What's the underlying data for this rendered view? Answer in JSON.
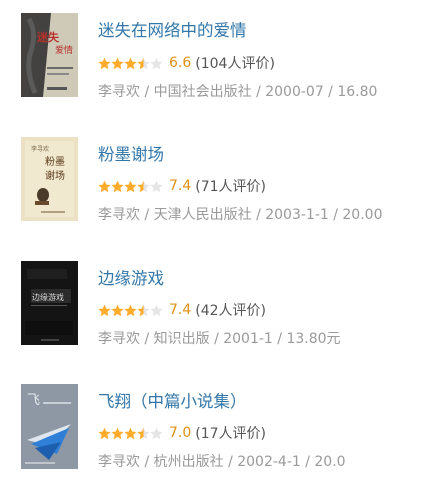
{
  "books": [
    {
      "title": "迷失在网络中的爱情",
      "rating": "6.6",
      "rating_value": 3.5,
      "count": "(104人评价)",
      "meta": "李寻欢 / 中国社会出版社 / 2000-07 / 16.80"
    },
    {
      "title": "粉墨谢场",
      "rating": "7.4",
      "rating_value": 3.5,
      "count": "(71人评价)",
      "meta": "李寻欢 / 天津人民出版社 / 2003-1-1 / 20.00"
    },
    {
      "title": "边缘游戏",
      "rating": "7.4",
      "rating_value": 3.5,
      "count": "(42人评价)",
      "meta": "李寻欢 / 知识出版 / 2001-1 / 13.80元"
    },
    {
      "title": "飞翔（中篇小说集）",
      "rating": "7.0",
      "rating_value": 3.5,
      "count": "(17人评价)",
      "meta": "李寻欢 / 杭州出版社 / 2002-4-1 / 20.0"
    }
  ],
  "colors": {
    "title": "#3377aa",
    "star_on": "#ffac2d",
    "star_off": "#e5e5e5",
    "rating_number": "#e09015",
    "meta": "#9a9a9a"
  }
}
